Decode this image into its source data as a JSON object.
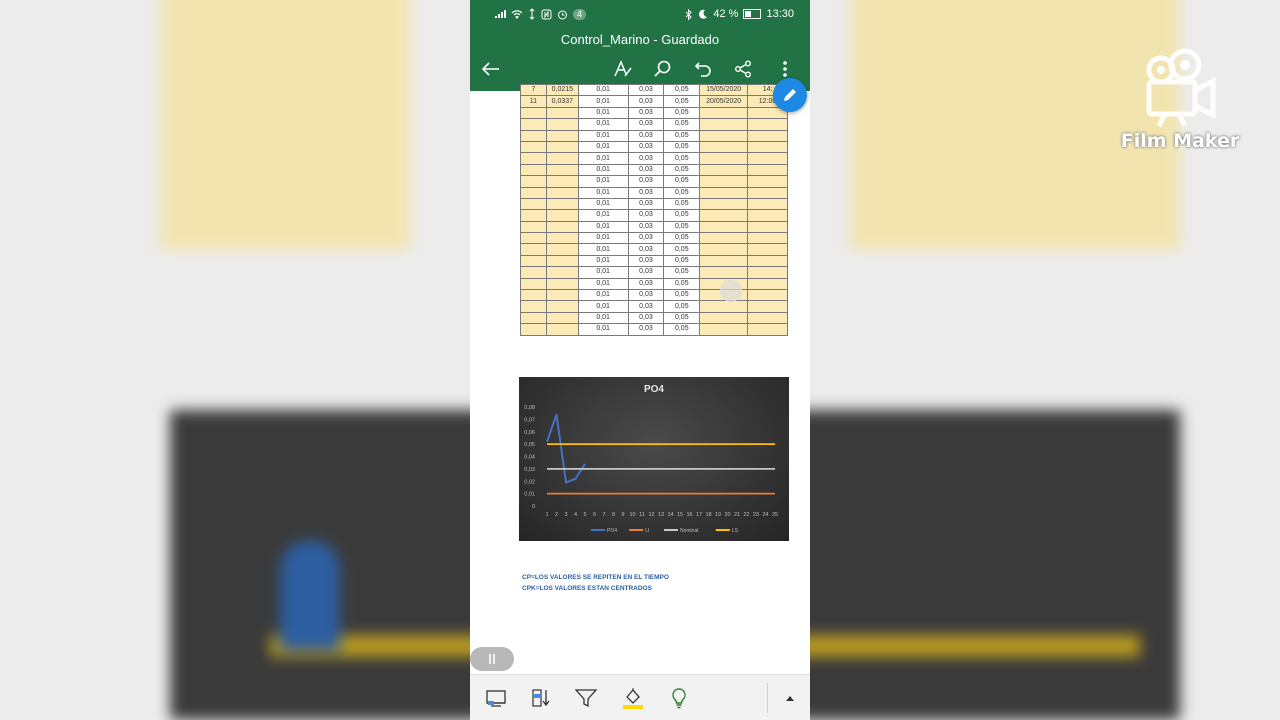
{
  "status_bar": {
    "notif_count": "4",
    "battery": "42 %",
    "time": "13:30"
  },
  "app": {
    "doc_title": "Control_Marino - Guardado"
  },
  "toolbar": {
    "icons": [
      "back-arrow-icon",
      "text-format-icon",
      "search-icon",
      "undo-icon",
      "share-icon",
      "more-icon"
    ]
  },
  "sheet": {
    "top_partial_row": [
      "7",
      "0,0215",
      "0,01",
      "0,03",
      "0,05",
      "15/05/2020",
      "14:"
    ],
    "row_11": [
      "11",
      "0,0337",
      "0,01",
      "0,03",
      "0,05",
      "20/05/2020",
      "12:00"
    ],
    "repeated_values": [
      "0,01",
      "0,03",
      "0,05"
    ],
    "empty_rows": 20
  },
  "chart_data": {
    "type": "line",
    "title": "PO4",
    "x": [
      1,
      2,
      3,
      4,
      5,
      6,
      7,
      8,
      9,
      10,
      11,
      12,
      13,
      14,
      15,
      16,
      17,
      18,
      19,
      20,
      21,
      22,
      23,
      24,
      25
    ],
    "ylim": [
      0,
      0.08
    ],
    "yticks": [
      "0",
      "0,01",
      "0,02",
      "0,03",
      "0,04",
      "0,05",
      "0,06",
      "0,07",
      "0,08"
    ],
    "series": [
      {
        "name": "PO4",
        "color": "#4472c4",
        "values": [
          0.052,
          0.074,
          0.019,
          0.022,
          0.034
        ]
      },
      {
        "name": "LI",
        "color": "#ed7d31",
        "values": [
          0.01,
          0.01,
          0.01,
          0.01,
          0.01,
          0.01,
          0.01,
          0.01,
          0.01,
          0.01,
          0.01,
          0.01,
          0.01,
          0.01,
          0.01,
          0.01,
          0.01,
          0.01,
          0.01,
          0.01,
          0.01,
          0.01,
          0.01,
          0.01,
          0.01
        ]
      },
      {
        "name": "Nominal",
        "color": "#c8c8c8",
        "values": [
          0.03,
          0.03,
          0.03,
          0.03,
          0.03,
          0.03,
          0.03,
          0.03,
          0.03,
          0.03,
          0.03,
          0.03,
          0.03,
          0.03,
          0.03,
          0.03,
          0.03,
          0.03,
          0.03,
          0.03,
          0.03,
          0.03,
          0.03,
          0.03,
          0.03
        ]
      },
      {
        "name": "LS",
        "color": "#ffc000",
        "values": [
          0.05,
          0.05,
          0.05,
          0.05,
          0.05,
          0.05,
          0.05,
          0.05,
          0.05,
          0.05,
          0.05,
          0.05,
          0.05,
          0.05,
          0.05,
          0.05,
          0.05,
          0.05,
          0.05,
          0.05,
          0.05,
          0.05,
          0.05,
          0.05,
          0.05
        ]
      }
    ],
    "legend_position": "bottom"
  },
  "notes": {
    "line1": "CP=LOS VALORES SE REPITEN EN EL TIEMPO",
    "line2": "CPK=LOS VALORES ESTAN CENTRADOS"
  },
  "bottom_toolbar": {
    "icons": [
      "sheet-view-icon",
      "sort-icon",
      "filter-icon",
      "fill-color-icon",
      "ideas-lightbulb-icon",
      "expand-up-icon"
    ],
    "fill_color": "#ffd800"
  },
  "watermark": {
    "label": "Film Maker"
  },
  "colors": {
    "excel_green": "#217346",
    "cell_yellow": "#fcebb6",
    "fab_blue": "#1e88e5",
    "note_blue": "#2b5fa6"
  }
}
